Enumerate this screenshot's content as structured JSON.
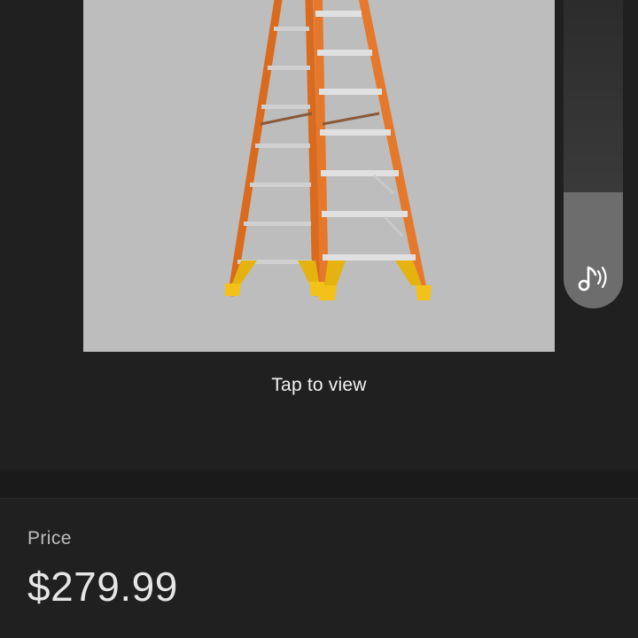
{
  "product": {
    "image_icon": "ladder-image",
    "tap_label": "Tap to view"
  },
  "side_panel": {
    "audio_icon": "music-note-audio-icon"
  },
  "price": {
    "label": "Price",
    "value": "$279.99"
  },
  "colors": {
    "background": "#202020",
    "image_background": "#bdbdbd",
    "ladder_orange": "#e6782b",
    "ladder_rung": "#d9d9d9",
    "ladder_feet": "#f3c117"
  }
}
